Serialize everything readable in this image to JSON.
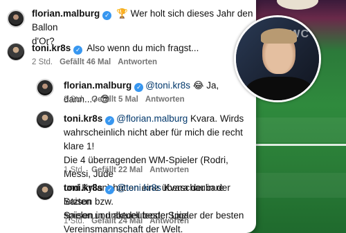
{
  "comments": [
    {
      "user": "florian.malburg",
      "verified": true,
      "emoji": "🏆",
      "text_line1": "Wer holt sich dieses Jahr den Ballon",
      "text_line2": "d'Or?"
    },
    {
      "user": "toni.kr8s",
      "verified": true,
      "text": "Also wenn du mich fragst...",
      "time": "2 Std.",
      "likes": "Gefällt 46 Mal",
      "reply": "Antworten"
    },
    {
      "user": "florian.malburg",
      "verified": true,
      "mention": "@toni.kr8s",
      "text": "😂 Ja, dann...? 😎",
      "time": "2 Std.",
      "likes": "Gefällt 5 Mal",
      "reply": "Antworten"
    },
    {
      "user": "toni.kr8s",
      "verified": true,
      "mention": "@florian.malburg",
      "text_line1": "Kvara. Wirds",
      "text_line2": "wahrscheinlich nicht aber für mich die recht klare 1!",
      "text_line3": "Die 4 überragenden WM-Spieler (Rodri, Messi, Jude",
      "text_line4": "und Kylian) hatten eine überschaubare Saison bzw.",
      "text_line5": "spielen in unbedeutender Liga.",
      "time": "1 Std.",
      "likes": "Gefällt 22 Mal",
      "reply": "Antworten"
    },
    {
      "user": "toni.kr8s",
      "verified": true,
      "mention": "@toni.kr8s",
      "text_line1": "Kvara der in der letzten",
      "text_line2": "Saison und aktuell beste Spieler der besten",
      "text_line3": "Vereinsmannschaft der Welt.",
      "time": "1 Std.",
      "likes": "Gefällt 24 Mal",
      "reply": "Antworten"
    }
  ],
  "photo": {
    "logo_text": "IWC"
  },
  "colors": {
    "mention": "#00376b",
    "verified": "#3897f0",
    "meta": "#737373"
  }
}
